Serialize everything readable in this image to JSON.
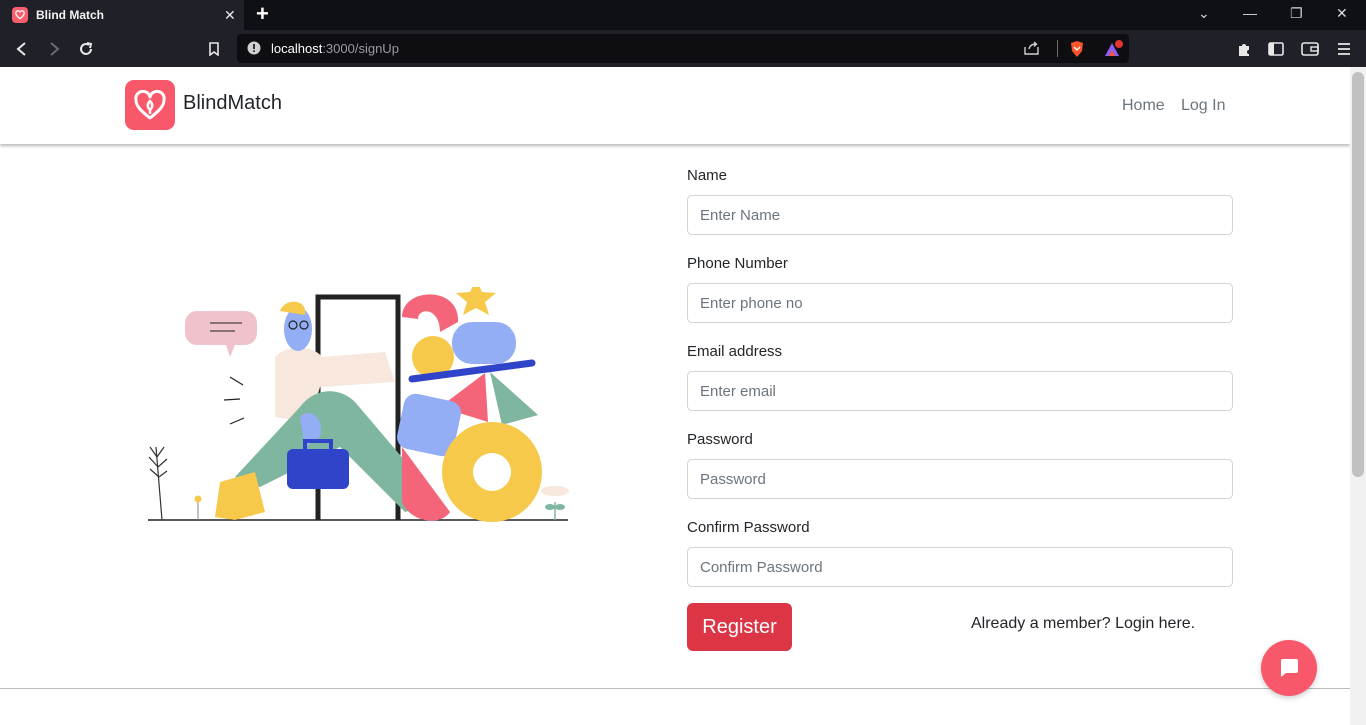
{
  "browser": {
    "tab_title": "Blind Match",
    "tab_close": "✕",
    "new_tab": "+",
    "url_host": "localhost",
    "url_path": ":3000/signUp",
    "window_controls": [
      "⌄",
      "—",
      "❐",
      "✕"
    ]
  },
  "navbar": {
    "brand": "BlindMatch",
    "links": [
      "Home",
      "Log In"
    ]
  },
  "form": {
    "fields": [
      {
        "label": "Name",
        "placeholder": "Enter Name"
      },
      {
        "label": "Phone Number",
        "placeholder": "Enter phone no"
      },
      {
        "label": "Email address",
        "placeholder": "Enter email"
      },
      {
        "label": "Password",
        "placeholder": "Password"
      },
      {
        "label": "Confirm Password",
        "placeholder": "Confirm Password"
      }
    ],
    "submit_label": "Register",
    "login_prompt": "Already a member? Login here."
  },
  "icons": {
    "brand_logo": "heart-icon",
    "chat": "chat-bubble-icon"
  },
  "colors": {
    "brand": "#f9576a",
    "register": "#dc3545"
  }
}
